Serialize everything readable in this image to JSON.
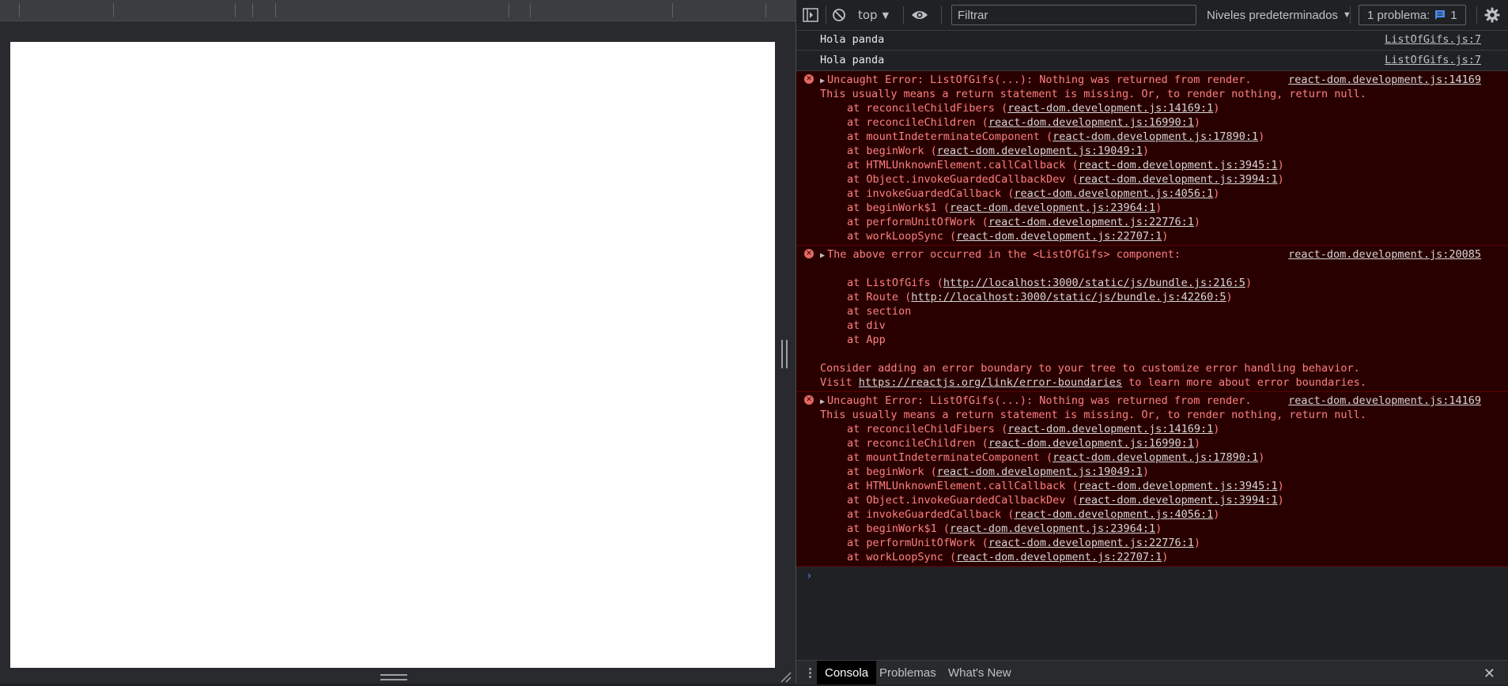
{
  "console_toolbar": {
    "context": "top",
    "filter_placeholder": "Filtrar",
    "levels": "Niveles predeterminados",
    "issues_label": "1 problema:",
    "issues_count": "1"
  },
  "log_messages": [
    {
      "text": "Hola panda",
      "source": "ListOfGifs.js:7"
    },
    {
      "text": "Hola panda",
      "source": "ListOfGifs.js:7"
    }
  ],
  "error1": {
    "headline": "Uncaught Error: ListOfGifs(...): Nothing was returned from render.",
    "source": "react-dom.development.js:14169",
    "line2": "This usually means a return statement is missing. Or, to render nothing, return null.",
    "stack": [
      {
        "fn": "at reconcileChildFibers (",
        "link": "react-dom.development.js:14169:1",
        "end": ")"
      },
      {
        "fn": "at reconcileChildren (",
        "link": "react-dom.development.js:16990:1",
        "end": ")"
      },
      {
        "fn": "at mountIndeterminateComponent (",
        "link": "react-dom.development.js:17890:1",
        "end": ")"
      },
      {
        "fn": "at beginWork (",
        "link": "react-dom.development.js:19049:1",
        "end": ")"
      },
      {
        "fn": "at HTMLUnknownElement.callCallback (",
        "link": "react-dom.development.js:3945:1",
        "end": ")"
      },
      {
        "fn": "at Object.invokeGuardedCallbackDev (",
        "link": "react-dom.development.js:3994:1",
        "end": ")"
      },
      {
        "fn": "at invokeGuardedCallback (",
        "link": "react-dom.development.js:4056:1",
        "end": ")"
      },
      {
        "fn": "at beginWork$1 (",
        "link": "react-dom.development.js:23964:1",
        "end": ")"
      },
      {
        "fn": "at performUnitOfWork (",
        "link": "react-dom.development.js:22776:1",
        "end": ")"
      },
      {
        "fn": "at workLoopSync (",
        "link": "react-dom.development.js:22707:1",
        "end": ")"
      }
    ]
  },
  "error2": {
    "headline": "The above error occurred in the <ListOfGifs> component:",
    "source": "react-dom.development.js:20085",
    "stack": [
      {
        "fn": "at ListOfGifs (",
        "link": "http://localhost:3000/static/js/bundle.js:216:5",
        "end": ")"
      },
      {
        "fn": "at Route (",
        "link": "http://localhost:3000/static/js/bundle.js:42260:5",
        "end": ")"
      },
      {
        "fn": "at section",
        "link": "",
        "end": ""
      },
      {
        "fn": "at div",
        "link": "",
        "end": ""
      },
      {
        "fn": "at App",
        "link": "",
        "end": ""
      }
    ],
    "advice1": "Consider adding an error boundary to your tree to customize error handling behavior.",
    "advice2_pre": "Visit ",
    "advice2_link": "https://reactjs.org/link/error-boundaries",
    "advice2_post": " to learn more about error boundaries."
  },
  "error3": {
    "headline": "Uncaught Error: ListOfGifs(...): Nothing was returned from render.",
    "source": "react-dom.development.js:14169",
    "line2": "This usually means a return statement is missing. Or, to render nothing, return null.",
    "stack": [
      {
        "fn": "at reconcileChildFibers (",
        "link": "react-dom.development.js:14169:1",
        "end": ")"
      },
      {
        "fn": "at reconcileChildren (",
        "link": "react-dom.development.js:16990:1",
        "end": ")"
      },
      {
        "fn": "at mountIndeterminateComponent (",
        "link": "react-dom.development.js:17890:1",
        "end": ")"
      },
      {
        "fn": "at beginWork (",
        "link": "react-dom.development.js:19049:1",
        "end": ")"
      },
      {
        "fn": "at HTMLUnknownElement.callCallback (",
        "link": "react-dom.development.js:3945:1",
        "end": ")"
      },
      {
        "fn": "at Object.invokeGuardedCallbackDev (",
        "link": "react-dom.development.js:3994:1",
        "end": ")"
      },
      {
        "fn": "at invokeGuardedCallback (",
        "link": "react-dom.development.js:4056:1",
        "end": ")"
      },
      {
        "fn": "at beginWork$1 (",
        "link": "react-dom.development.js:23964:1",
        "end": ")"
      },
      {
        "fn": "at performUnitOfWork (",
        "link": "react-dom.development.js:22776:1",
        "end": ")"
      },
      {
        "fn": "at workLoopSync (",
        "link": "react-dom.development.js:22707:1",
        "end": ")"
      }
    ]
  },
  "prompt_symbol": "›",
  "drawer_tabs": [
    {
      "label": "Consola",
      "active": true
    },
    {
      "label": "Problemas",
      "active": false
    },
    {
      "label": "What's New",
      "active": false
    }
  ],
  "colors": {
    "error_bg": "#290000",
    "error_text": "#ff8080",
    "panel_bg": "#202124",
    "issue_accent": "#4d8cf0"
  }
}
